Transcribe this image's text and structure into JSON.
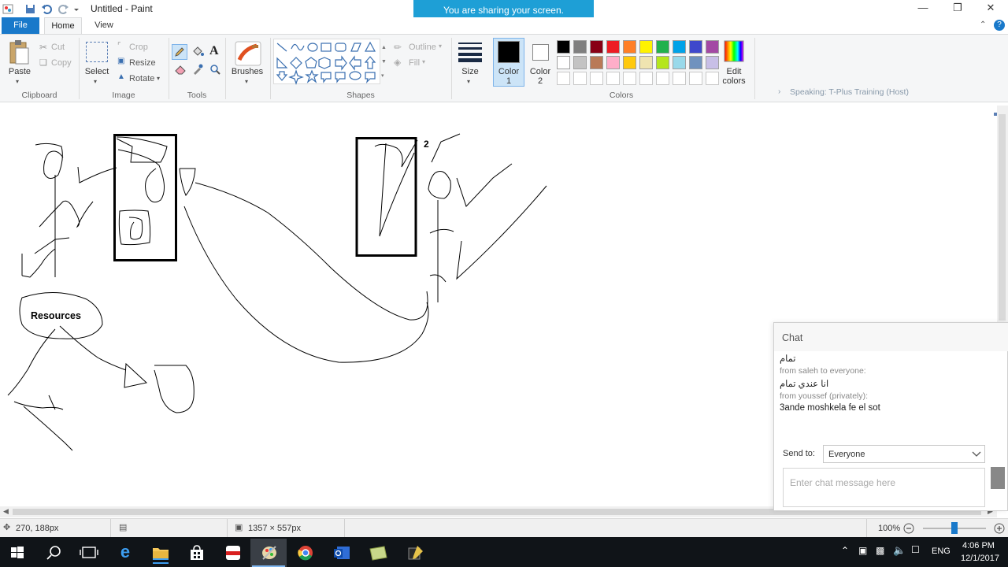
{
  "window": {
    "title": "Untitled - Paint",
    "share_banner": "You are sharing your screen."
  },
  "tabs": [
    {
      "label": "File"
    },
    {
      "label": "Home"
    },
    {
      "label": "View"
    }
  ],
  "ribbon": {
    "clipboard": {
      "paste": "Paste",
      "cut": "Cut",
      "copy": "Copy",
      "group": "Clipboard"
    },
    "image": {
      "select": "Select",
      "crop": "Crop",
      "resize": "Resize",
      "rotate": "Rotate",
      "group": "Image"
    },
    "tools": {
      "group": "Tools"
    },
    "brushes": {
      "label": "Brushes"
    },
    "shapes": {
      "outline": "Outline",
      "fill": "Fill",
      "group": "Shapes"
    },
    "size": {
      "label": "Size"
    },
    "colors": {
      "color1_label": "Color\n1",
      "color1_l1": "Color",
      "color1_l2": "1",
      "color2_l1": "Color",
      "color2_l2": "2",
      "edit_l1": "Edit",
      "edit_l2": "colors",
      "group": "Colors",
      "palette_row1": [
        "#000000",
        "#7f7f7f",
        "#880015",
        "#ed1c24",
        "#ff7f27",
        "#fff200",
        "#22b14c",
        "#00a2e8",
        "#3f48cc",
        "#a349a4"
      ],
      "palette_row2": [
        "#ffffff",
        "#c3c3c3",
        "#b97a57",
        "#ffaec9",
        "#ffc90e",
        "#efe4b0",
        "#b5e61d",
        "#99d9ea",
        "#7092be",
        "#c8bfe7"
      ],
      "color1": "#000000",
      "color2": "#ffffff"
    },
    "speaking": "Speaking: T-Plus Training (Host)"
  },
  "canvas": {
    "annotations": {
      "resources_label": "Resources",
      "number_label": "2"
    }
  },
  "status": {
    "cursor_pos": "270, 188px",
    "canvas_size": "1357 × 557px",
    "zoom": "100%",
    "zoom_level": 0.5
  },
  "chat": {
    "title": "Chat",
    "messages": [
      {
        "text": "تمام"
      },
      {
        "from": "from saleh to everyone:",
        "text": "انا عندي تمام"
      },
      {
        "from": "from youssef (privately):",
        "text": "3ande moshkela fe el sot"
      }
    ],
    "send_to_label": "Send to:",
    "send_to_value": "Everyone",
    "input_placeholder": "Enter chat message here"
  },
  "taskbar": {
    "icons": [
      "start-icon",
      "search-icon",
      "task-view-icon",
      "edge-icon",
      "file-explorer-icon",
      "store-icon",
      "app-icon",
      "paint-icon",
      "chrome-icon",
      "outlook-icon",
      "notepad-icon",
      "pen-app-icon"
    ],
    "language": "ENG",
    "time": "4:06 PM",
    "date": "12/1/2017"
  }
}
